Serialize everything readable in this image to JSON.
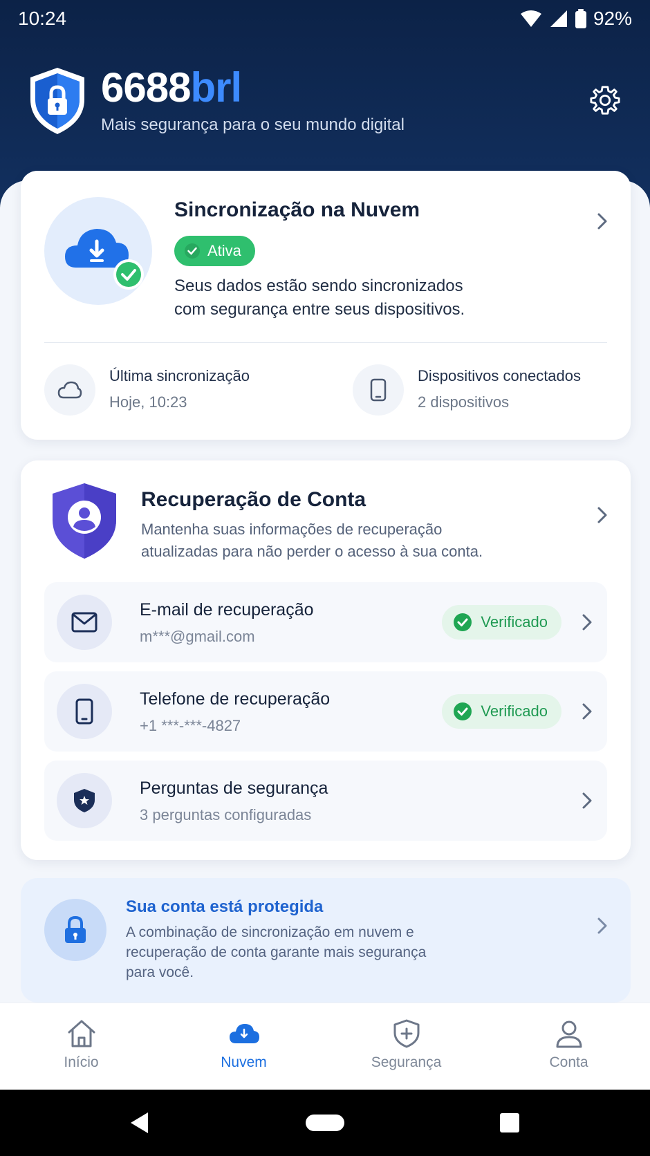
{
  "status_bar": {
    "time": "10:24",
    "battery": "92%"
  },
  "header": {
    "brand_main": "6688",
    "brand_accent": "brl",
    "tagline": "Mais segurança para o seu mundo digital"
  },
  "sync_card": {
    "title": "Sincronização na Nuvem",
    "status": "Ativa",
    "description_line1": "Seus dados estão sendo sincronizados",
    "description_line2": "com segurança entre seus dispositivos.",
    "last_sync_label": "Última sincronização",
    "last_sync_value": "Hoje, 10:23",
    "devices_label": "Dispositivos conectados",
    "devices_value": "2 dispositivos"
  },
  "recovery_card": {
    "title": "Recuperação de Conta",
    "description_line1": "Mantenha suas informações de recuperação",
    "description_line2": "atualizadas para não perder o acesso à sua conta.",
    "items": [
      {
        "title": "E-mail de recuperação",
        "value": "m***@gmail.com",
        "status": "Verificado",
        "icon": "mail-icon"
      },
      {
        "title": "Telefone de recuperação",
        "value": "+1 ***-***-4827",
        "status": "Verificado",
        "icon": "phone-icon"
      },
      {
        "title": "Perguntas de segurança",
        "value": "3 perguntas configuradas",
        "icon": "shield-star-icon"
      }
    ]
  },
  "protected_card": {
    "title": "Sua conta está protegida",
    "line1": "A combinação de sincronização em nuvem e",
    "line2": "recuperação de conta garante mais segurança",
    "line3": "para você."
  },
  "bottom_nav": {
    "active": "Nuvem",
    "items": [
      {
        "label": "Início",
        "icon": "home-icon"
      },
      {
        "label": "Nuvem",
        "icon": "cloud-icon"
      },
      {
        "label": "Segurança",
        "icon": "shield-plus-icon"
      },
      {
        "label": "Conta",
        "icon": "user-icon"
      }
    ]
  },
  "colors": {
    "header_bg": "#0c2247",
    "accent_blue": "#1c6fe0",
    "success_green": "#2fbf6e",
    "recovery_purple": "#5b4fd6"
  }
}
